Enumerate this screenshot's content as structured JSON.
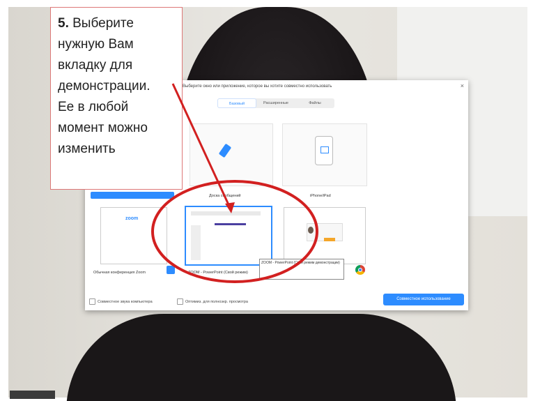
{
  "callout": {
    "step_number": "5.",
    "text": " Выберите\nнужную Вам\nвкладку для\nдемонстрации.\nЕе в любой\nмомент можно\nизменить"
  },
  "dialog": {
    "title": "Выберите окно или приложение, которое вы хотите совместно использовать",
    "close_symbol": "×",
    "tabs": [
      {
        "label": "Базовый",
        "active": true
      },
      {
        "label": "Расширенные",
        "active": false
      },
      {
        "label": "Файлы",
        "active": false
      }
    ],
    "tiles": [
      {
        "label": "Доска сообщений",
        "icon": "pen-icon"
      },
      {
        "label": "iPhone/iPad",
        "icon": "phone-icon"
      },
      {
        "label": "Обычная конференция Zoom",
        "icon": "zoom-icon"
      },
      {
        "label": "ZOOM - PowerPoint (Свой режим)",
        "icon": "powerpoint-icon",
        "selected": true
      },
      {
        "label": "",
        "icon": "chrome-icon"
      }
    ],
    "zoom_logo_text": "zoom",
    "tooltip": "ZOOM - PowerPoint (Свой режим демонстрации)",
    "options": {
      "share_sound_label": "Совместное звука компьютера",
      "optimize_label": "Оптимиз. для полноэкр. просмотра"
    },
    "share_button_label": "Совместное использование"
  },
  "colors": {
    "accent": "#2d8cff",
    "annotation": "#d22020"
  }
}
